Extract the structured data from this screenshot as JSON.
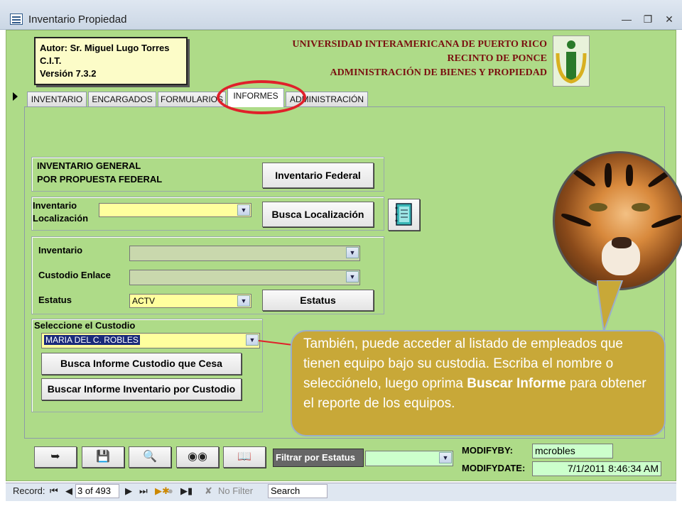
{
  "window": {
    "title": "Inventario Propiedad",
    "controls": [
      "minimize-icon",
      "restore-icon",
      "close-icon"
    ]
  },
  "header": {
    "author": "Autor:  Sr. Miguel Lugo Torres",
    "org": "C.I.T.",
    "version": "Versión 7.3.2",
    "university": "UNIVERSIDAD INTERAMERICANA DE PUERTO RICO",
    "campus": "RECINTO DE PONCE",
    "department": "ADMINISTRACIÓN DE BIENES Y PROPIEDAD"
  },
  "tabs": [
    {
      "label": "INVENTARIO"
    },
    {
      "label": "ENCARGADOS"
    },
    {
      "label": "FORMULARIOS"
    },
    {
      "label": "INFORMES"
    },
    {
      "label": "ADMINISTRACIÓN"
    }
  ],
  "informes": {
    "federal_label_1": "INVENTARIO GENERAL",
    "federal_label_2": "POR PROPUESTA FEDERAL",
    "federal_button": "Inventario Federal",
    "loc_label_1": "Inventario",
    "loc_label_2": "Localización",
    "loc_value": "",
    "loc_button": "Busca Localización",
    "inv_label": "Inventario",
    "inv_value": "",
    "custodio_label": "Custodio Enlace",
    "custodio_value": "",
    "estatus_label": "Estatus",
    "estatus_value": "ACTV",
    "estatus_button": "Estatus",
    "seleccione_label": "Seleccione el Custodio",
    "custodio_selected": "MARIA DEL C. ROBLES",
    "cesa_button": "Busca Informe Custodio que Cesa",
    "inv_custodio_button": "Buscar Informe Inventario por Custodio"
  },
  "callout": {
    "text_1": "También, puede acceder al listado de empleados que tienen equipo bajo su custodia. Escriba el nombre o selecciónelo, luego oprima ",
    "bold": "Buscar Informe",
    "text_2": " para obtener el reporte de los equipos."
  },
  "toolbar": {
    "icons": [
      "exit-icon",
      "save-edit-icon",
      "find-next-icon",
      "binoculars-icon",
      "book-icon"
    ],
    "filter_label": "Filtrar por Estatus",
    "filter_value": "",
    "modifyby_label": "MODIFYBY:",
    "modifyby_value": "mcrobles",
    "modifydate_label": "MODIFYDATE:",
    "modifydate_value": "7/1/2011 8:46:34 AM"
  },
  "statusbar": {
    "record_label": "Record:",
    "record_position": "3 of 493",
    "no_filter": "No Filter",
    "search": "Search"
  }
}
